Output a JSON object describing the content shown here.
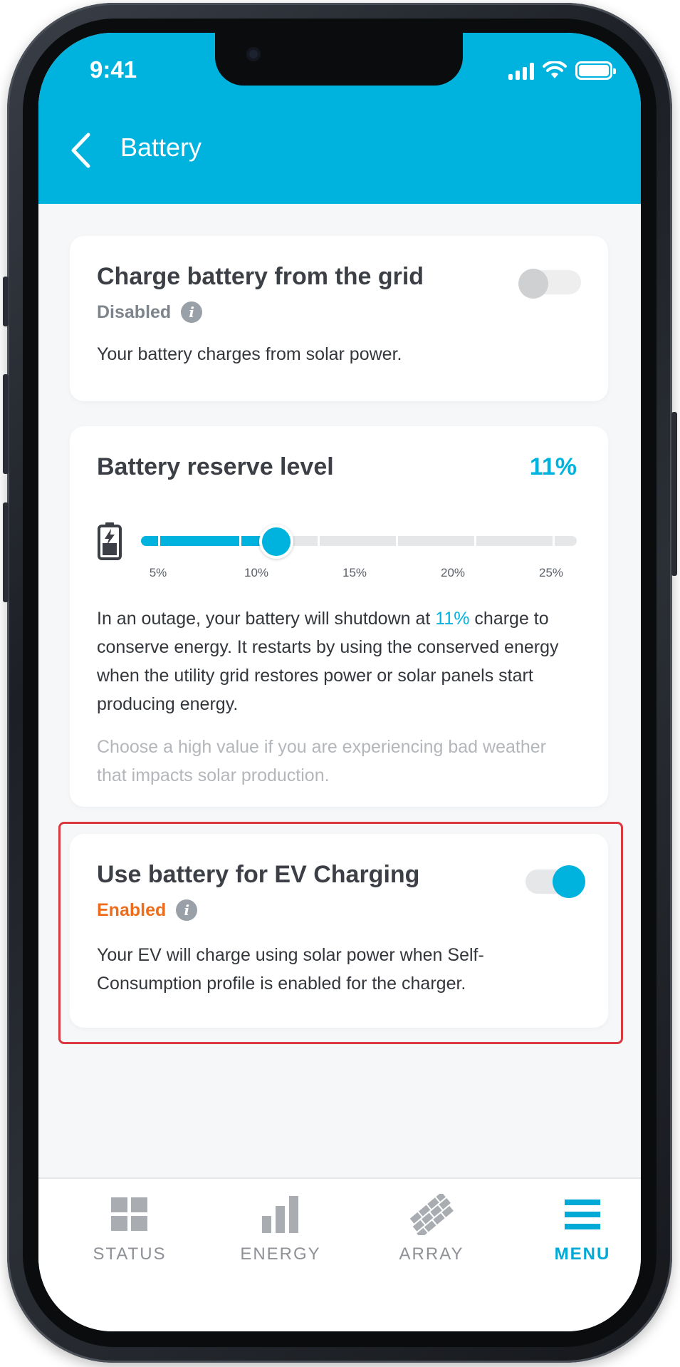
{
  "status_bar": {
    "time": "9:41"
  },
  "header": {
    "title": "Battery"
  },
  "grid_card": {
    "title": "Charge battery from the grid",
    "status": "Disabled",
    "description": "Your battery charges from solar power.",
    "toggle_on": false
  },
  "reserve_card": {
    "title": "Battery reserve level",
    "value": "11%",
    "slider_value_percent": 11,
    "slider_min_percent": 5,
    "slider_max_percent": 25,
    "tick_labels": [
      "5%",
      "10%",
      "15%",
      "20%",
      "25%"
    ],
    "desc_before": "In an outage, your battery will shutdown at ",
    "desc_value": "11%",
    "desc_after": " charge to conserve energy. It restarts by using the conserved energy when the utility grid restores power or solar panels start producing energy.",
    "hint": "Choose a high value if you are experiencing bad weather that impacts solar production."
  },
  "ev_card": {
    "title": "Use battery for EV Charging",
    "status": "Enabled",
    "description": "Your EV will charge using solar power when Self-Consumption profile is enabled for the charger.",
    "toggle_on": true
  },
  "tabs": [
    {
      "label": "STATUS",
      "icon": "grid-icon",
      "active": false
    },
    {
      "label": "ENERGY",
      "icon": "bar-chart-icon",
      "active": false
    },
    {
      "label": "ARRAY",
      "icon": "solar-array-icon",
      "active": false
    },
    {
      "label": "MENU",
      "icon": "menu-icon",
      "active": true
    }
  ],
  "colors": {
    "accent": "#00b3df",
    "enabled": "#ef6c1a",
    "disabled": "#7d848c",
    "highlight": "#d9393f"
  }
}
